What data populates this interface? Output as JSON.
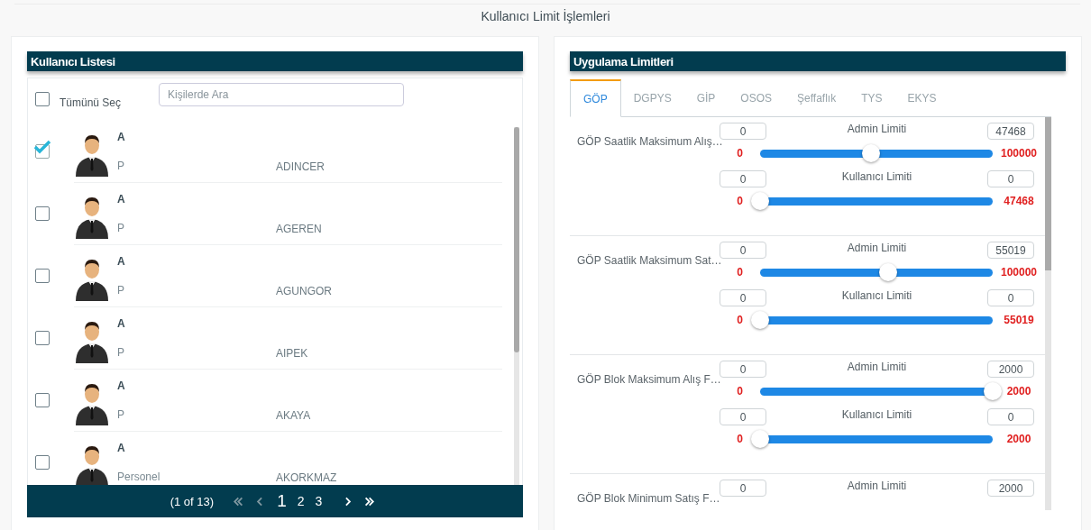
{
  "page_title": "Kullanıcı Limit İşlemleri",
  "user_list": {
    "title": "Kullanıcı Listesi",
    "select_all": {
      "label": "Tümünü Seç",
      "checked": false
    },
    "search": {
      "placeholder": "Kişilerde Ara"
    },
    "users": [
      {
        "name": "A",
        "role": "P",
        "username": "ADINCER",
        "checked": true
      },
      {
        "name": "A",
        "role": "P",
        "username": "AGEREN",
        "checked": false
      },
      {
        "name": "A",
        "role": "P",
        "username": "AGUNGOR",
        "checked": false
      },
      {
        "name": "A",
        "role": "P",
        "username": "AIPEK",
        "checked": false
      },
      {
        "name": "A",
        "role": "P",
        "username": "AKAYA",
        "checked": false
      },
      {
        "name": "A",
        "role": "Personel",
        "username": "AKORKMAZ",
        "checked": false
      }
    ],
    "pagination": {
      "summary": "(1 of 13)",
      "nav_before": [
        {
          "kind": "first",
          "disabled": true
        },
        {
          "kind": "prev",
          "disabled": true
        }
      ],
      "pages": [
        {
          "label": "1",
          "selected": true
        },
        {
          "label": "2",
          "selected": false
        },
        {
          "label": "3",
          "selected": false
        }
      ],
      "nav_after": [
        {
          "kind": "next",
          "disabled": false
        },
        {
          "kind": "last",
          "disabled": false
        }
      ]
    }
  },
  "limits": {
    "title": "Uygulama Limitleri",
    "tabs": [
      {
        "label": "GÖP",
        "selected": true
      },
      {
        "label": "DGPYS",
        "selected": false
      },
      {
        "label": "GİP",
        "selected": false
      },
      {
        "label": "OSOS",
        "selected": false
      },
      {
        "label": "Şeffaflık",
        "selected": false
      },
      {
        "label": "TYS",
        "selected": false
      },
      {
        "label": "EKYS",
        "selected": false
      }
    ],
    "sections": [
      {
        "label": "GÖP Saatlik Maksimum Alış…",
        "limits": [
          {
            "label": "Admin Limiti",
            "low": "0",
            "high": "47468",
            "min": "0",
            "max": "100000",
            "level": 0.475
          },
          {
            "label": "Kullanıcı Limiti",
            "low": "0",
            "high": "0",
            "min": "0",
            "max": "47468",
            "level": 0
          }
        ]
      },
      {
        "label": "GÖP Saatlik Maksimum Sat…",
        "limits": [
          {
            "label": "Admin Limiti",
            "low": "0",
            "high": "55019",
            "min": "0",
            "max": "100000",
            "level": 0.55
          },
          {
            "label": "Kullanıcı Limiti",
            "low": "0",
            "high": "0",
            "min": "0",
            "max": "55019",
            "level": 0
          }
        ]
      },
      {
        "label": "GÖP Blok Maksimum Alış F…",
        "limits": [
          {
            "label": "Admin Limiti",
            "low": "0",
            "high": "2000",
            "min": "0",
            "max": "2000",
            "level": 1
          },
          {
            "label": "Kullanıcı Limiti",
            "low": "0",
            "high": "0",
            "min": "0",
            "max": "2000",
            "level": 0
          }
        ]
      },
      {
        "label": "GÖP Blok Minimum Satış F…",
        "limits": [
          {
            "label": "Admin Limiti",
            "low": "0",
            "high": "2000"
          }
        ]
      }
    ]
  }
}
